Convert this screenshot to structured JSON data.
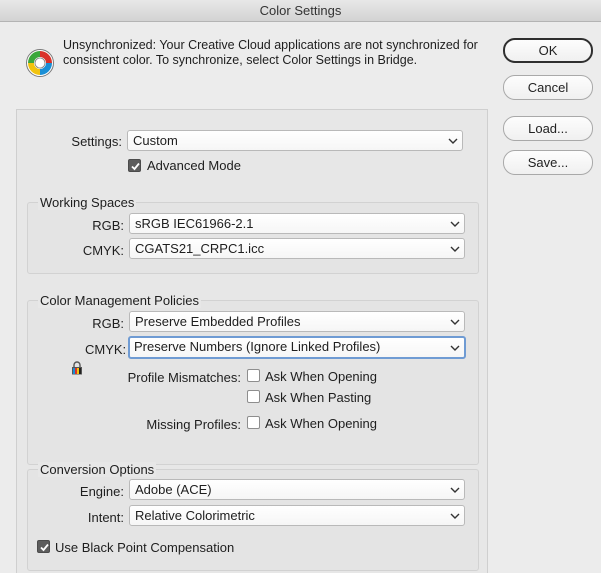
{
  "window": {
    "title": "Color Settings"
  },
  "notice": {
    "text": "Unsynchronized: Your Creative Cloud applications are not synchronized for consistent color. To synchronize, select Color Settings in Bridge.",
    "icon": "color-wheel-icon"
  },
  "buttons": {
    "ok": "OK",
    "cancel": "Cancel",
    "load": "Load...",
    "save": "Save..."
  },
  "settings": {
    "label": "Settings:",
    "value": "Custom",
    "advanced_mode": {
      "label": "Advanced Mode",
      "checked": true
    }
  },
  "working_spaces": {
    "title": "Working Spaces",
    "rgb": {
      "label": "RGB:",
      "value": "sRGB IEC61966-2.1"
    },
    "cmyk": {
      "label": "CMYK:",
      "value": "CGATS21_CRPC1.icc"
    }
  },
  "policies": {
    "title": "Color Management Policies",
    "rgb": {
      "label": "RGB:",
      "value": "Preserve Embedded Profiles"
    },
    "cmyk": {
      "label": "CMYK:",
      "value": "Preserve Numbers (Ignore Linked Profiles)",
      "icon": "lock-icon"
    },
    "mismatches": {
      "label": "Profile Mismatches:",
      "ask_opening": {
        "label": "Ask When Opening",
        "checked": false
      },
      "ask_pasting": {
        "label": "Ask When Pasting",
        "checked": false
      }
    },
    "missing": {
      "label": "Missing Profiles:",
      "ask_opening": {
        "label": "Ask When Opening",
        "checked": false
      }
    }
  },
  "conversion": {
    "title": "Conversion Options",
    "engine": {
      "label": "Engine:",
      "value": "Adobe (ACE)"
    },
    "intent": {
      "label": "Intent:",
      "value": "Relative Colorimetric"
    },
    "black_point": {
      "label": "Use Black Point Compensation",
      "checked": true
    }
  }
}
